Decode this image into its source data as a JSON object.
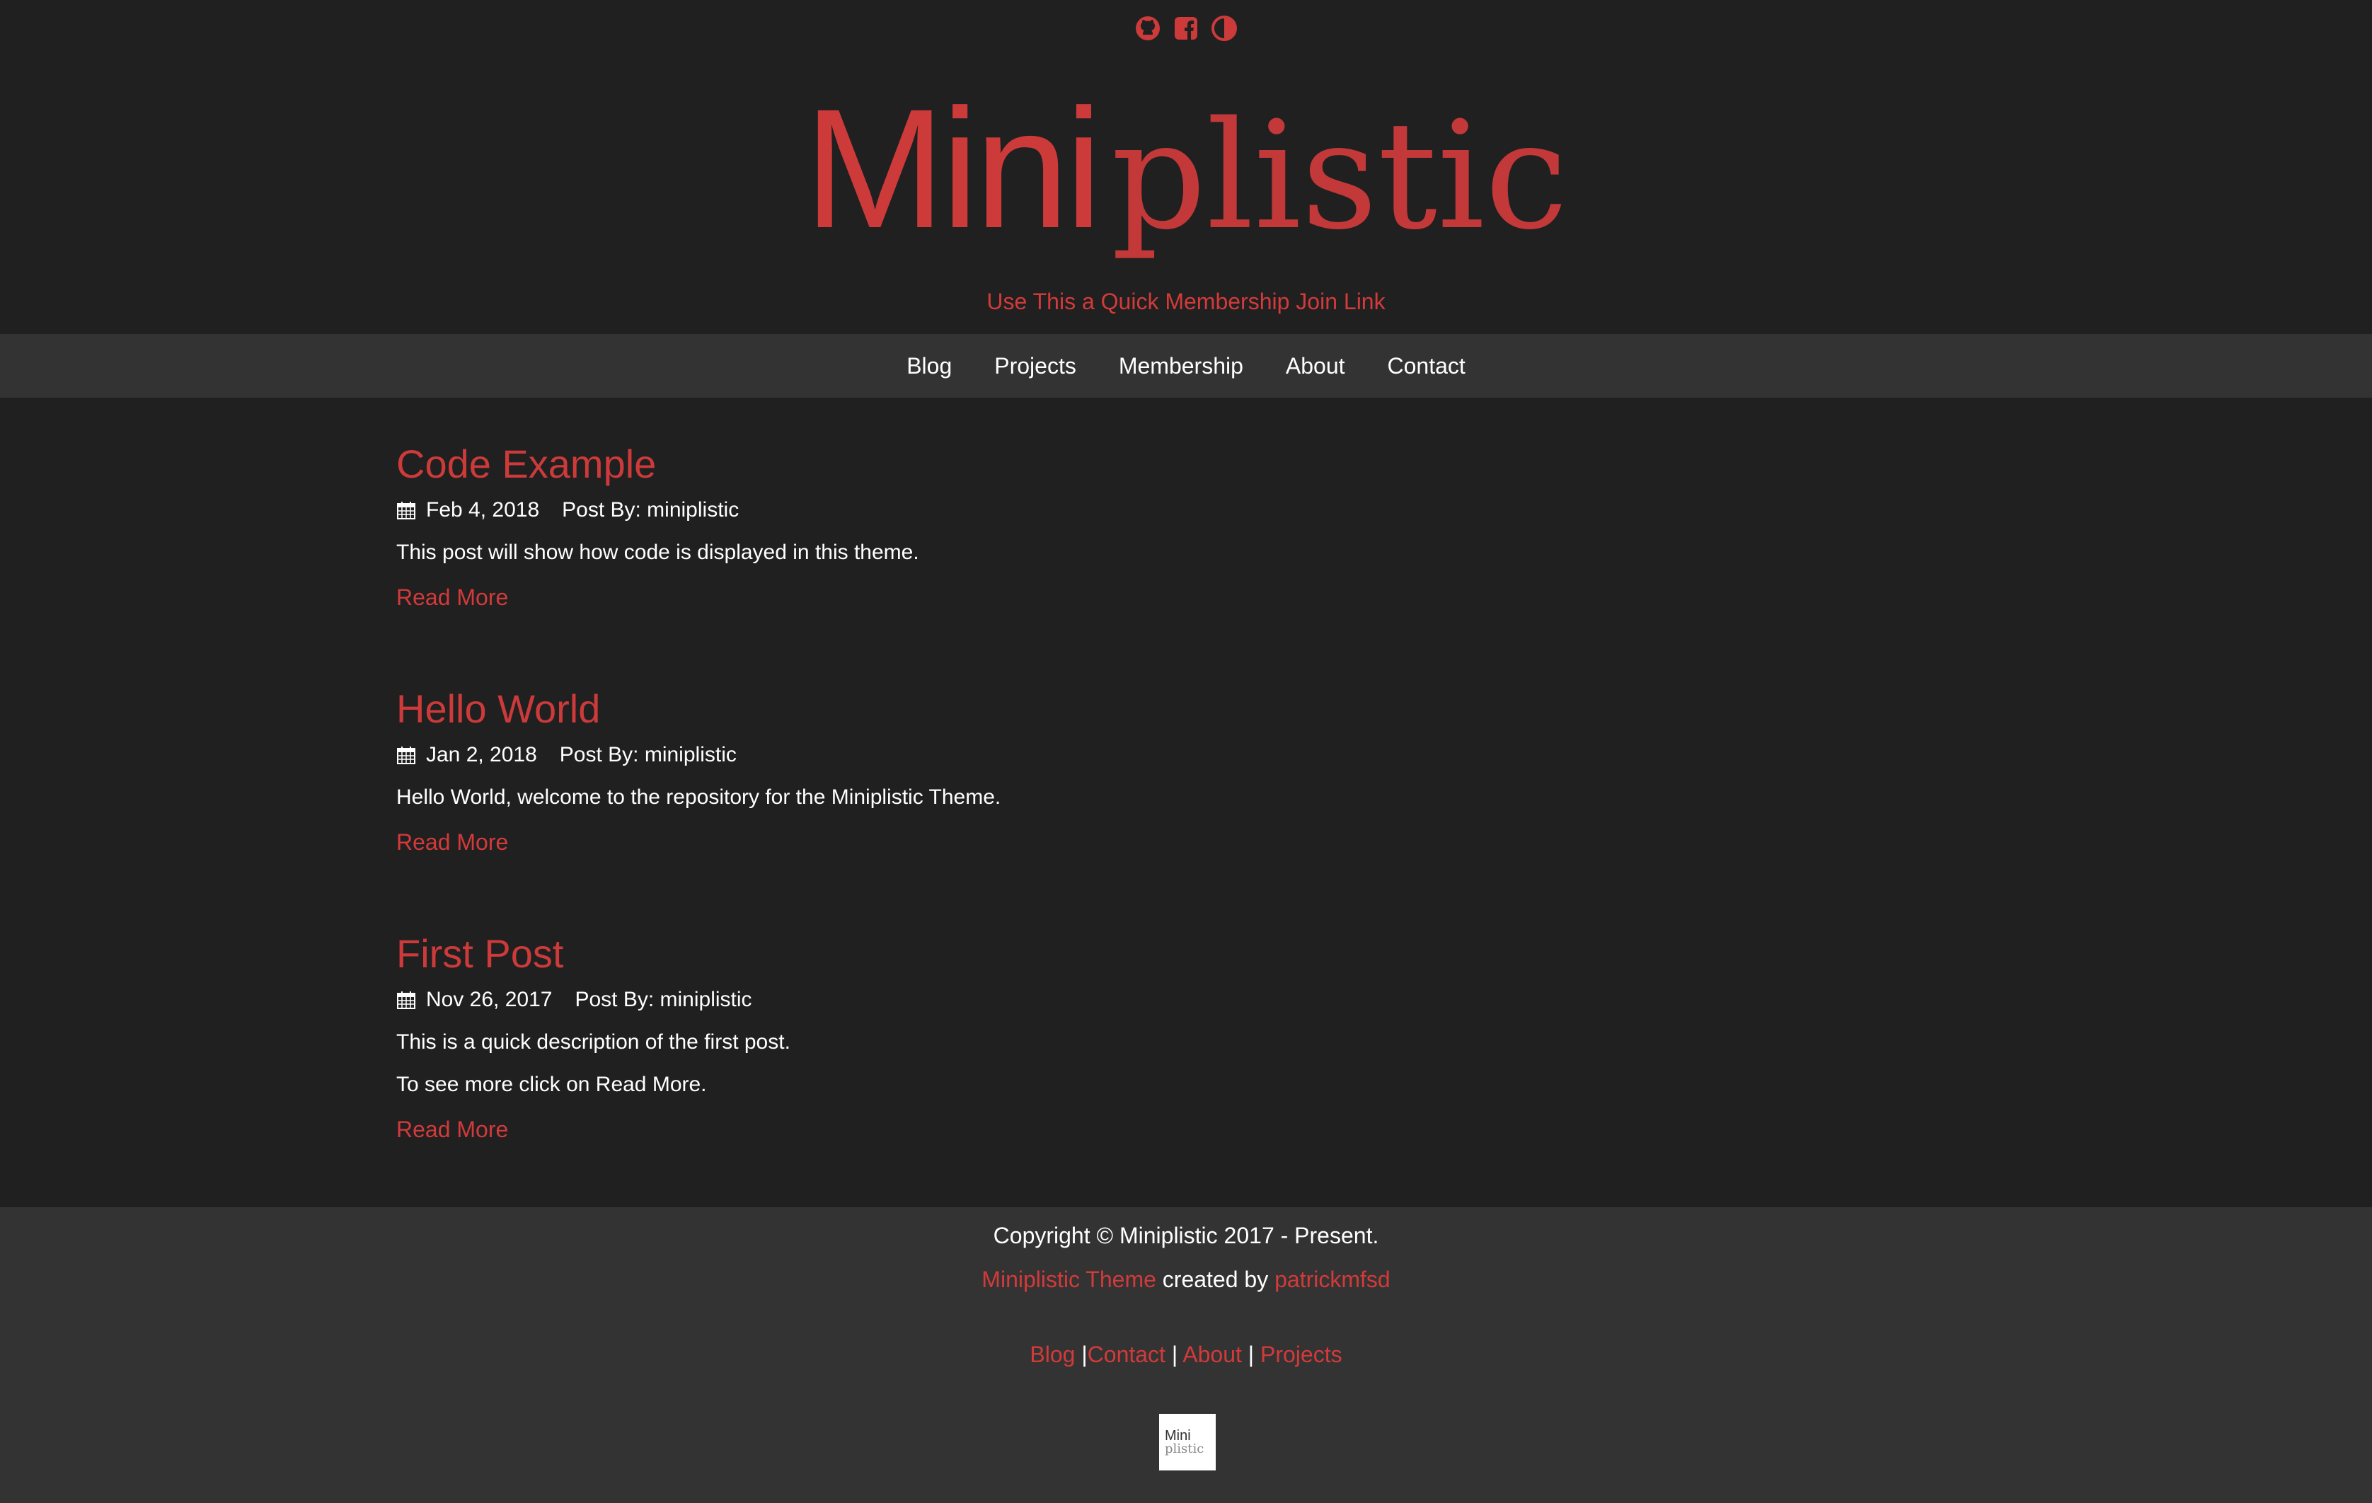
{
  "header": {
    "social_icons": [
      "github-icon",
      "facebook-square-icon",
      "adjust-icon"
    ],
    "logo_part1": "Mini",
    "logo_part2": "plistic",
    "tagline": "Use This a Quick Membership Join Link",
    "accent_color": "#cc3a3a",
    "background_color": "#202021"
  },
  "nav": {
    "items": [
      {
        "label": "Blog"
      },
      {
        "label": "Projects"
      },
      {
        "label": "Membership"
      },
      {
        "label": "About"
      },
      {
        "label": "Contact"
      }
    ],
    "background_color": "#333333"
  },
  "posts": [
    {
      "title": "Code Example",
      "date": "Feb 4, 2018",
      "author": "Post By: miniplistic",
      "description": [
        "This post will show how code is displayed in this theme."
      ],
      "read_more": "Read More"
    },
    {
      "title": "Hello World",
      "date": "Jan 2, 2018",
      "author": "Post By: miniplistic",
      "description": [
        "Hello World, welcome to the repository for the Miniplistic Theme."
      ],
      "read_more": "Read More"
    },
    {
      "title": "First Post",
      "date": "Nov 26, 2017",
      "author": "Post By: miniplistic",
      "description": [
        "This is a quick description of the first post.",
        "To see more click on Read More."
      ],
      "read_more": "Read More"
    }
  ],
  "footer": {
    "copyright": "Copyright © Miniplistic 2017 - Present.",
    "theme_link": "Miniplistic Theme",
    "created_by": " created by ",
    "author_link": "patrickmfsd",
    "links": [
      "Blog",
      "Contact",
      "About",
      "Projects"
    ],
    "separator": "|",
    "logo_part1": "Mini",
    "logo_part2": "plistic"
  }
}
